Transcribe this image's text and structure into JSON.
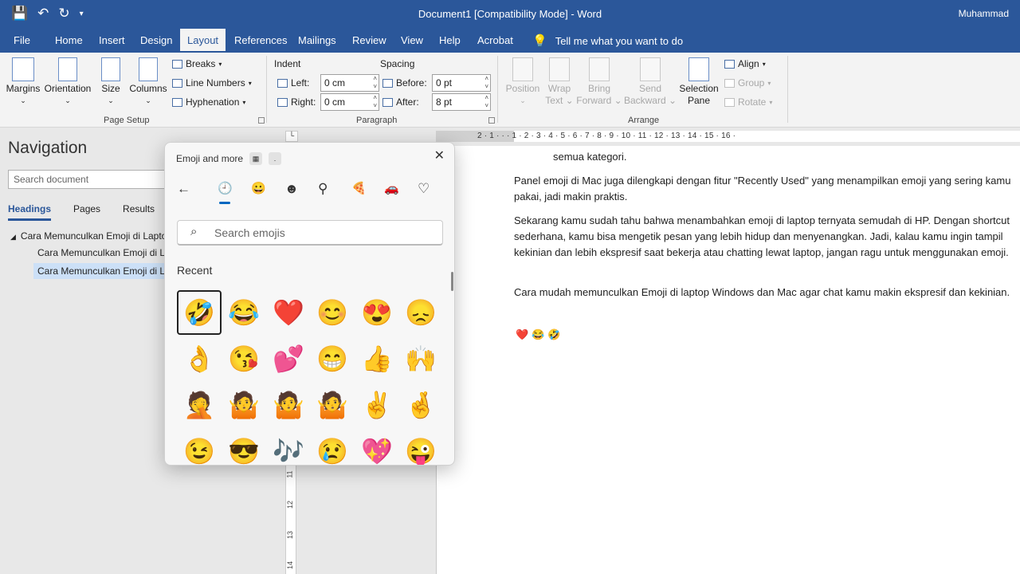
{
  "title_bar": {
    "doc_title": "Document1 [Compatibility Mode]  -  Word",
    "user": "Muhammad",
    "qat": [
      "save-icon",
      "undo-icon",
      "redo-icon",
      "customize-icon"
    ]
  },
  "tabs": [
    "File",
    "Home",
    "Insert",
    "Design",
    "Layout",
    "References",
    "Mailings",
    "Review",
    "View",
    "Help",
    "Acrobat"
  ],
  "active_tab": "Layout",
  "tell_me": "Tell me what you want to do",
  "ribbon": {
    "page_setup": {
      "margins": "Margins",
      "orientation": "Orientation",
      "size": "Size",
      "columns": "Columns",
      "breaks": "Breaks",
      "line_numbers": "Line Numbers",
      "hyphenation": "Hyphenation",
      "group_label": "Page Setup"
    },
    "paragraph": {
      "indent_label": "Indent",
      "spacing_label": "Spacing",
      "left_label": "Left:",
      "left_value": "0 cm",
      "right_label": "Right:",
      "right_value": "0 cm",
      "before_label": "Before:",
      "before_value": "0 pt",
      "after_label": "After:",
      "after_value": "8 pt",
      "group_label": "Paragraph"
    },
    "arrange": {
      "position": "Position",
      "wrap_text_1": "Wrap",
      "wrap_text_2": "Text",
      "bring_forward_1": "Bring",
      "bring_forward_2": "Forward",
      "send_backward_1": "Send",
      "send_backward_2": "Backward",
      "selection_pane_1": "Selection",
      "selection_pane_2": "Pane",
      "align": "Align",
      "group": "Group",
      "rotate": "Rotate",
      "group_label": "Arrange"
    }
  },
  "navigation": {
    "title": "Navigation",
    "search_placeholder": "Search document",
    "tabs": [
      "Headings",
      "Pages",
      "Results"
    ],
    "items": [
      "Cara Memunculkan Emoji di Laptop",
      "Cara Memunculkan Emoji di Laptop",
      "Cara Memunculkan Emoji di Laptop"
    ]
  },
  "ruler": {
    "numbers": "2 · 1 · · · 1 · 2 · 3 · 4 · 5 · 6 · 7 · 8 · 9 · 10 · 11 · 12 · 13 · 14 · 15 · 16 ·",
    "vertical": [
      "11",
      "12",
      "13",
      "14"
    ]
  },
  "document": {
    "paragraphs": [
      "semua kategori.",
      "Panel emoji di Mac juga dilengkapi dengan fitur \"Recently Used\" yang menampilkan emoji yang sering kamu pakai, jadi makin praktis.",
      "Sekarang kamu sudah tahu bahwa menambahkan emoji di laptop ternyata semudah di HP. Dengan shortcut sederhana, kamu bisa mengetik pesan yang lebih hidup dan menyenangkan. Jadi, kalau kamu ingin tampil kekinian dan lebih ekspresif saat bekerja atau chatting lewat laptop, jangan ragu untuk menggunakan emoji.",
      "Cara mudah memunculkan Emoji di laptop Windows dan Mac agar chat kamu makin ekspresif dan kekinian."
    ],
    "inline_emojis": [
      "❤️",
      "😂",
      "🤣"
    ]
  },
  "emoji_picker": {
    "title": "Emoji and more",
    "close": "✕",
    "categories": [
      "back-icon",
      "recent-icon",
      "smiley-icon",
      "people-icon",
      "celebration-icon",
      "food-icon",
      "travel-icon",
      "heart-icon"
    ],
    "category_glyphs": [
      "←",
      "🕘",
      "😀",
      "☻",
      "⚲",
      "🍕",
      "🚗",
      "♡"
    ],
    "search_placeholder": "Search emojis",
    "section": "Recent",
    "emojis": [
      "🤣",
      "😂",
      "❤️",
      "😊",
      "😍",
      "😞",
      "👌",
      "😘",
      "💕",
      "😁",
      "👍",
      "🙌",
      "🤦",
      "🤷",
      "🤷",
      "🤷",
      "✌️",
      "🤞",
      "😉",
      "😎",
      "🎶",
      "😢",
      "💖",
      "😜"
    ],
    "accent": "#0067c0"
  }
}
